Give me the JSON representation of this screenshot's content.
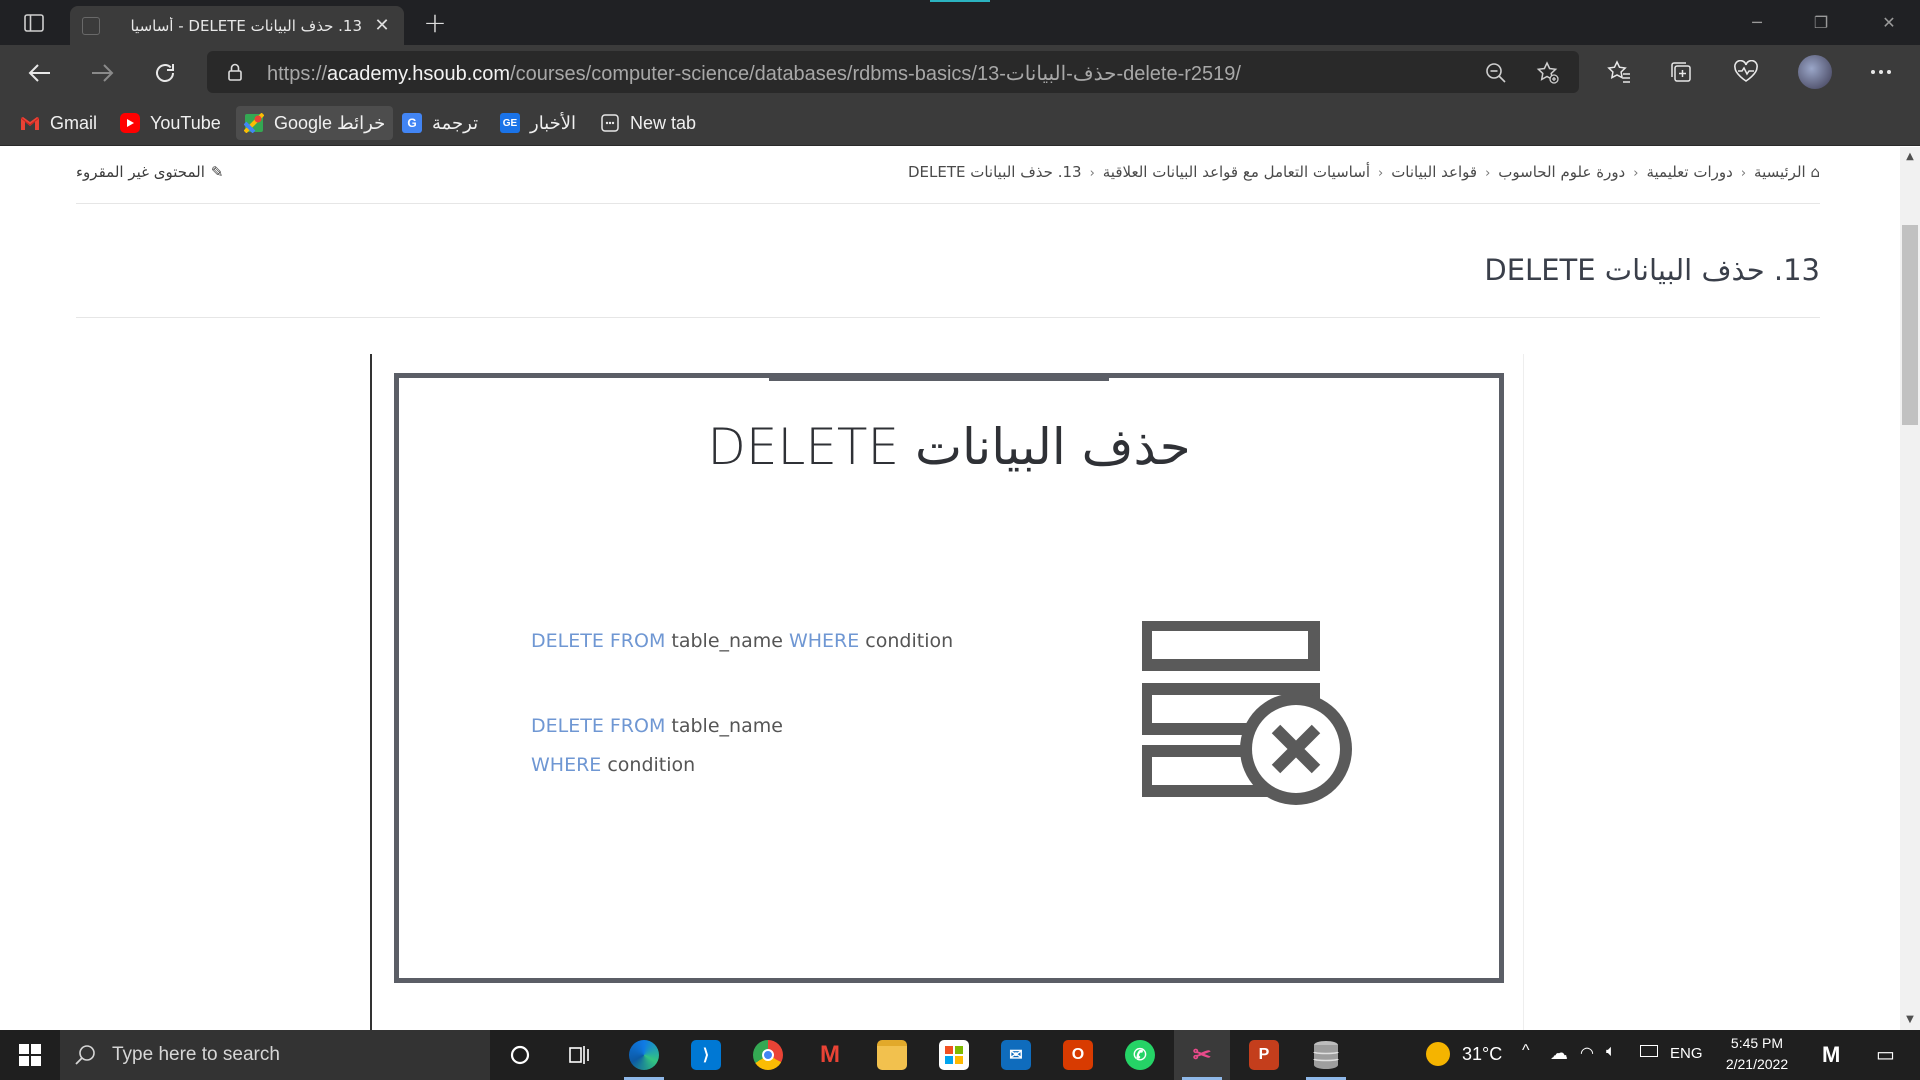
{
  "browser": {
    "tab_title": "13. حذف البيانات DELETE - أساسيا",
    "url_prefix": "https://",
    "url_host": "academy.hsoub.com",
    "url_path": "/courses/computer-science/databases/rdbms-basics/13-حذف-البيانات-delete-r2519/",
    "bookmarks": [
      {
        "label": "Gmail",
        "icon": "gmail-icon"
      },
      {
        "label": "YouTube",
        "icon": "youtube-icon"
      },
      {
        "label": "Google خرائط",
        "icon": "maps-icon"
      },
      {
        "label": "ترجمة",
        "icon": "translate-icon"
      },
      {
        "label": "الأخبار",
        "icon": "news-icon"
      },
      {
        "label": "New tab",
        "icon": "new-tab-icon"
      }
    ]
  },
  "page": {
    "breadcrumb": [
      "الرئيسية",
      "دورات تعليمية",
      "دورة علوم الحاسوب",
      "قواعد البيانات",
      "أساسيات التعامل مع قواعد البيانات العلاقية",
      "13. حذف البيانات DELETE"
    ],
    "unread_label": "المحتوى غير المقروء",
    "title": "13. حذف البيانات DELETE",
    "slide": {
      "title": "حذف البيانات DELETE",
      "line1": {
        "kw1": "DELETE FROM",
        "t1": " table_name ",
        "kw2": "WHERE",
        "t2": " condition"
      },
      "line2": {
        "kw1": "DELETE FROM",
        "t1": " table_name"
      },
      "line3": {
        "kw1": "WHERE",
        "t1": " condition"
      }
    }
  },
  "taskbar": {
    "search_placeholder": "Type here to search",
    "weather": "31°C",
    "language": "ENG",
    "time": "5:45 PM",
    "date": "2/21/2022"
  },
  "colors": {
    "sql_keyword": "#6f97d3",
    "slide_border": "#5b5e66"
  }
}
